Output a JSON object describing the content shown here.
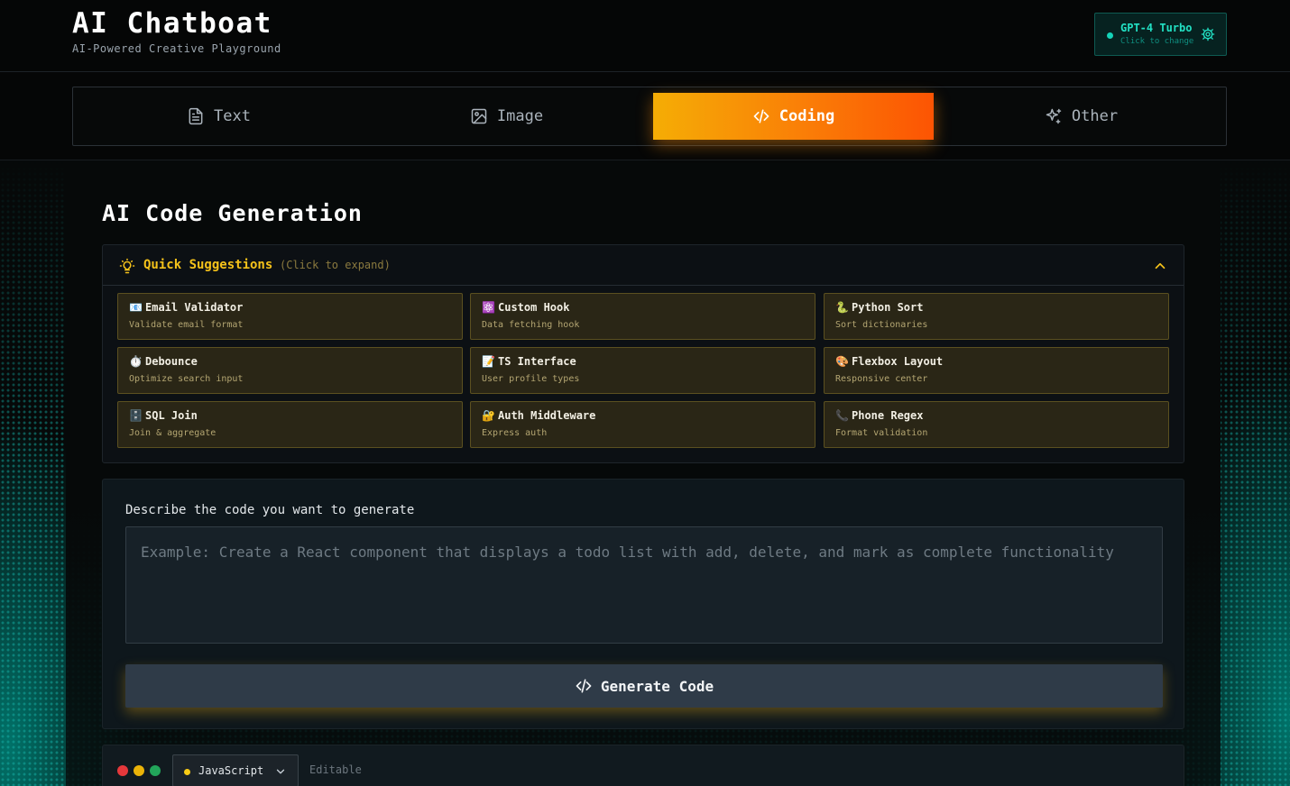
{
  "app": {
    "title": "AI Chatboat",
    "subtitle": "AI-Powered Creative Playground"
  },
  "model_picker": {
    "name": "GPT-4 Turbo",
    "hint": "Click to change",
    "status_color": "#14d3b8"
  },
  "tabs": [
    {
      "label": "Text",
      "icon": "document-icon",
      "active": false
    },
    {
      "label": "Image",
      "icon": "image-icon",
      "active": false
    },
    {
      "label": "Coding",
      "icon": "code-icon",
      "active": true
    },
    {
      "label": "Other",
      "icon": "sparkles-icon",
      "active": false
    }
  ],
  "section": {
    "title": "AI Code Generation"
  },
  "suggestions": {
    "title": "Quick Suggestions",
    "hint": "(Click to expand)",
    "expanded": true,
    "items": [
      {
        "emoji": "📧",
        "title": "Email Validator",
        "desc": "Validate email format"
      },
      {
        "emoji": "⚛️",
        "title": "Custom Hook",
        "desc": "Data fetching hook"
      },
      {
        "emoji": "🐍",
        "title": "Python Sort",
        "desc": "Sort dictionaries"
      },
      {
        "emoji": "⏱️",
        "title": "Debounce",
        "desc": "Optimize search input"
      },
      {
        "emoji": "📝",
        "title": "TS Interface",
        "desc": "User profile types"
      },
      {
        "emoji": "🎨",
        "title": "Flexbox Layout",
        "desc": "Responsive center"
      },
      {
        "emoji": "🗄️",
        "title": "SQL Join",
        "desc": "Join & aggregate"
      },
      {
        "emoji": "🔐",
        "title": "Auth Middleware",
        "desc": "Express auth"
      },
      {
        "emoji": "📞",
        "title": "Phone Regex",
        "desc": "Format validation"
      }
    ]
  },
  "prompt": {
    "label": "Describe the code you want to generate",
    "placeholder": "Example: Create a React component that displays a todo list with add, delete, and mark as complete functionality",
    "value": ""
  },
  "generate_button": {
    "label": "Generate Code"
  },
  "editor": {
    "language": "JavaScript",
    "mode": "Editable"
  },
  "colors": {
    "accent_start": "#f5ad05",
    "accent_end": "#fc5403",
    "teal": "#14d3b8",
    "suggestion_gold": "#f5c21a"
  }
}
